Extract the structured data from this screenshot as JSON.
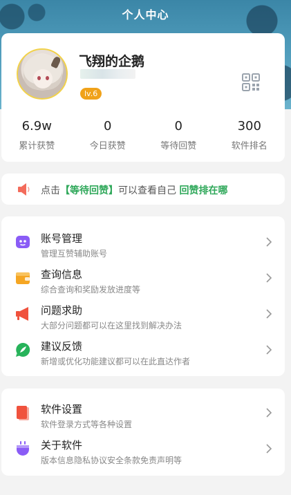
{
  "header": {
    "title": "个人中心"
  },
  "profile": {
    "username": "飞翔的企鹅",
    "level": "lv.6",
    "avatar_icon": "avatar-anime-girl",
    "qr_icon": "qr-code-icon"
  },
  "stats": [
    {
      "value": "6.9w",
      "label": "累计获赞"
    },
    {
      "value": "0",
      "label": "今日获赞"
    },
    {
      "value": "0",
      "label": "等待回赞"
    },
    {
      "value": "300",
      "label": "软件排名"
    }
  ],
  "notice": {
    "prefix": "点击",
    "highlight1": "【等待回赞】",
    "middle": "可以查看自己",
    "highlight2": "回赞排在哪",
    "icon": "speaker-icon"
  },
  "menu_group_1": [
    {
      "title": "账号管理",
      "subtitle": "管理互赞辅助账号",
      "icon": "robot-icon",
      "color": "#8a5cf6"
    },
    {
      "title": "查询信息",
      "subtitle": "综合查询和奖励发放进度等",
      "icon": "wallet-icon",
      "color": "#f5a623"
    },
    {
      "title": "问题求助",
      "subtitle": "大部分问题都可以在这里找到解决办法",
      "icon": "megaphone-icon",
      "color": "#f0523d"
    },
    {
      "title": "建议反馈",
      "subtitle": "新增或优化功能建议都可以在此直达作者",
      "icon": "feedback-icon",
      "color": "#27b35a"
    }
  ],
  "menu_group_2": [
    {
      "title": "软件设置",
      "subtitle": "软件登录方式等各种设置",
      "icon": "settings-card-icon",
      "color": "#f0523d"
    },
    {
      "title": "关于软件",
      "subtitle": "版本信息隐私协议安全条款免责声明等",
      "icon": "plugin-icon",
      "color": "#8a5cf6"
    }
  ],
  "colors": {
    "accent_green": "#2fa85a",
    "level_orange": "#f0a21a"
  }
}
